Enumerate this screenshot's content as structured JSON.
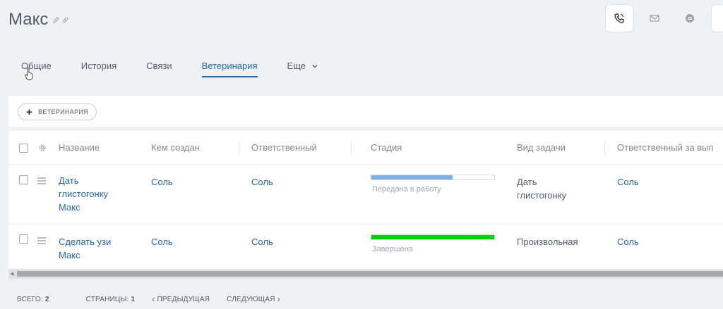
{
  "header": {
    "title": "Макс"
  },
  "tabs": [
    {
      "label": "Общие"
    },
    {
      "label": "История"
    },
    {
      "label": "Связи"
    },
    {
      "label": "Ветеринария",
      "active": true
    },
    {
      "label": "Еще"
    }
  ],
  "toolbar": {
    "add_label": "ВЕТЕРИНАРИЯ"
  },
  "grid": {
    "columns": [
      "Название",
      "Кем создан",
      "Ответственный",
      "Стадия",
      "Вид задачи",
      "Ответственный за вып"
    ],
    "rows": [
      {
        "name_lines": [
          "Дать",
          "глистогонку",
          "Макс"
        ],
        "created_by": "Соль",
        "responsible": "Соль",
        "stage": "Передана в работу",
        "stage_progress": 0.66,
        "stage_color": "#7fb1e6",
        "task_type_lines": [
          "Дать",
          "глистогонку"
        ],
        "executor": "Соль"
      },
      {
        "name_lines": [
          "Сделать узи",
          "Макс"
        ],
        "created_by": "Соль",
        "responsible": "Соль",
        "stage": "Завершена",
        "stage_progress": 1.0,
        "stage_color": "#00d100",
        "task_type_lines": [
          "Произвольная"
        ],
        "executor": "Соль"
      }
    ]
  },
  "footer": {
    "total_label": "ВСЕГО:",
    "total_value": "2",
    "pages_label": "СТРАНИЦЫ:",
    "pages_value": "1",
    "prev_label": "ПРЕДЫДУЩАЯ",
    "next_label": "СЛЕДУЮЩАЯ"
  },
  "icons": {
    "title": [
      "pencil-icon",
      "link-icon"
    ],
    "actions": [
      "phone-icon",
      "mail-icon",
      "chat-icon"
    ]
  }
}
